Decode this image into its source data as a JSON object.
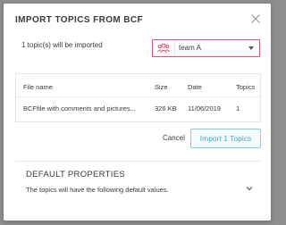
{
  "dialog": {
    "title": "IMPORT TOPICS FROM BCF",
    "summary": "1 topic(s) will be imported",
    "close_icon": "close-icon"
  },
  "team_select": {
    "icon": "team-icon",
    "value": "team A",
    "caret_icon": "caret-down-icon"
  },
  "table": {
    "headers": {
      "file_name": "File name",
      "size": "Size",
      "date": "Date",
      "topics": "Topics"
    },
    "rows": [
      {
        "file_name": "BCFfile with comments and pictures...",
        "size": "326 KB",
        "date": "11/06/2019",
        "topics": "1"
      }
    ]
  },
  "actions": {
    "cancel_label": "Cancel",
    "import_label": "Import 1 Topics"
  },
  "default_properties": {
    "title": "DEFAULT PROPERTIES",
    "description": "The topics will have the following default values.",
    "chevron_icon": "chevron-down-icon"
  },
  "colors": {
    "accent": "#4aa9c1",
    "accent_border": "#7fd0e0",
    "select_border": "#d9536e",
    "backdrop": "#8d8d8d"
  }
}
